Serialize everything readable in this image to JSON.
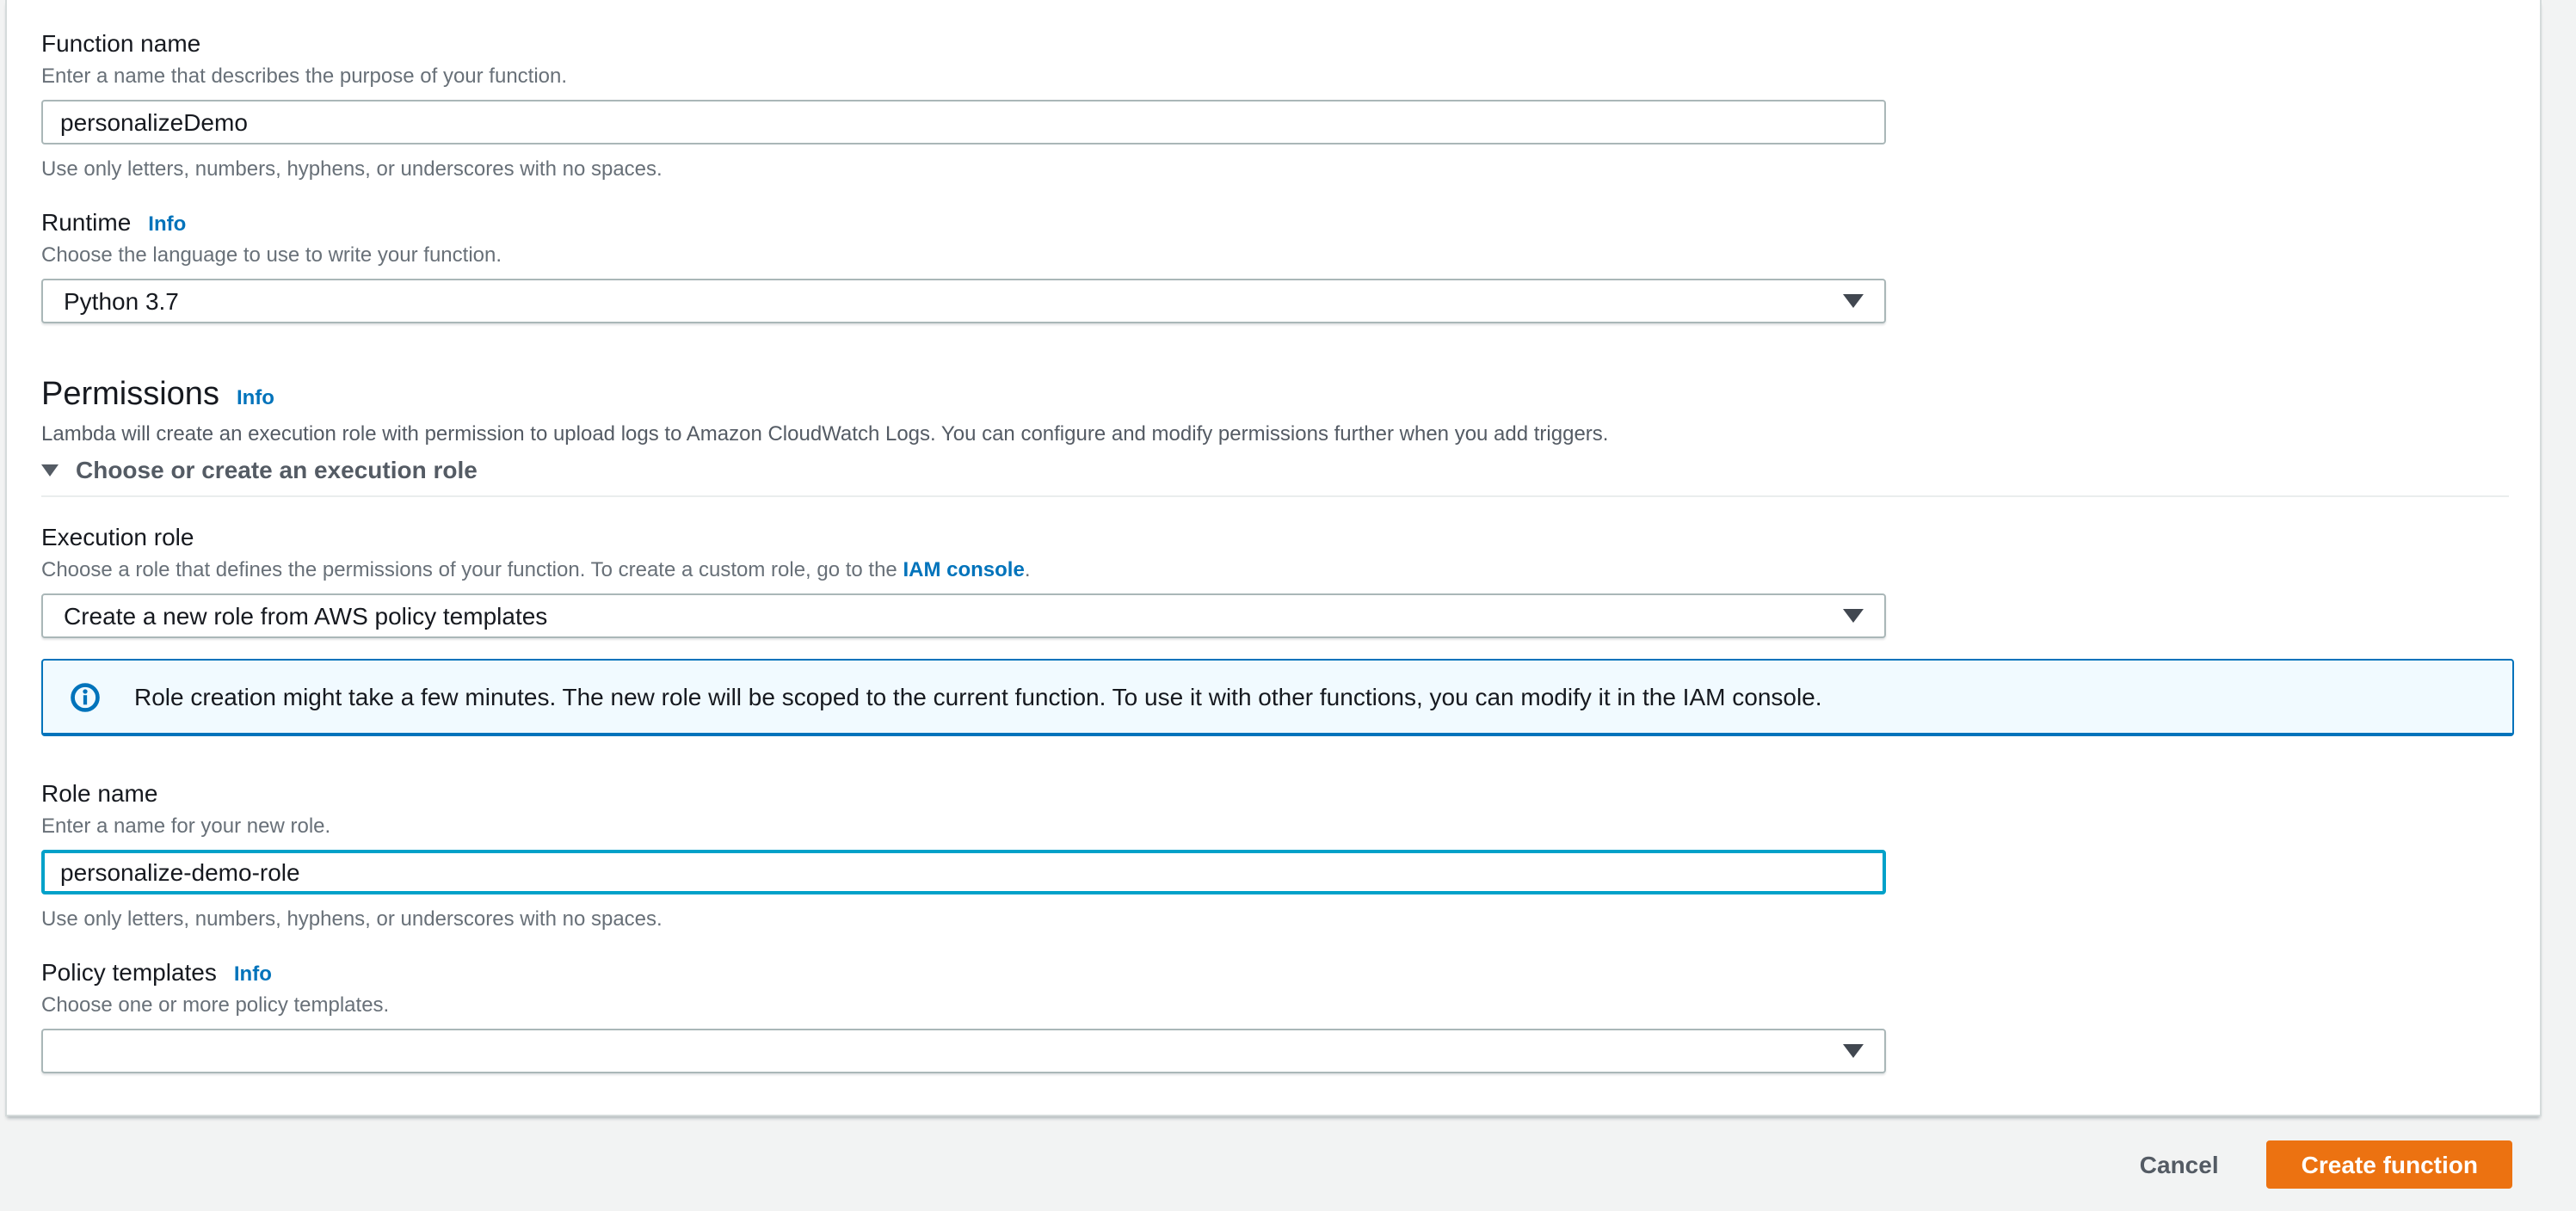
{
  "colors": {
    "page_bg": "#f2f3f3",
    "panel_bg": "#ffffff",
    "link_blue": "#0073bb",
    "focus_blue": "#00a1c9",
    "input_border": "#aab7b8",
    "alert_bg": "#f1faff",
    "alert_border": "#0073bb",
    "primary_orange": "#ec7211",
    "text_dark": "#16191f",
    "text_muted": "#687078"
  },
  "form": {
    "function_name": {
      "label": "Function name",
      "description": "Enter a name that describes the purpose of your function.",
      "value": "personalizeDemo",
      "constraint": "Use only letters, numbers, hyphens, or underscores with no spaces."
    },
    "runtime": {
      "label": "Runtime",
      "info_label": "Info",
      "description": "Choose the language to use to write your function.",
      "value": "Python 3.7"
    },
    "permissions": {
      "heading": "Permissions",
      "info_label": "Info",
      "description": "Lambda will create an execution role with permission to upload logs to Amazon CloudWatch Logs. You can configure and modify permissions further when you add triggers.",
      "expander_label": "Choose or create an execution role"
    },
    "execution_role": {
      "label": "Execution role",
      "description_prefix": "Choose a role that defines the permissions of your function. To create a custom role, go to the ",
      "description_link": "IAM console",
      "description_suffix": ".",
      "value": "Create a new role from AWS policy templates"
    },
    "alert": {
      "text": "Role creation might take a few minutes. The new role will be scoped to the current function. To use it with other functions, you can modify it in the IAM console."
    },
    "role_name": {
      "label": "Role name",
      "description": "Enter a name for your new role.",
      "value": "personalize-demo-role",
      "constraint": "Use only letters, numbers, hyphens, or underscores with no spaces."
    },
    "policy_templates": {
      "label": "Policy templates",
      "info_label": "Info",
      "description": "Choose one or more policy templates.",
      "value": ""
    }
  },
  "footer": {
    "cancel_label": "Cancel",
    "create_label": "Create function"
  }
}
